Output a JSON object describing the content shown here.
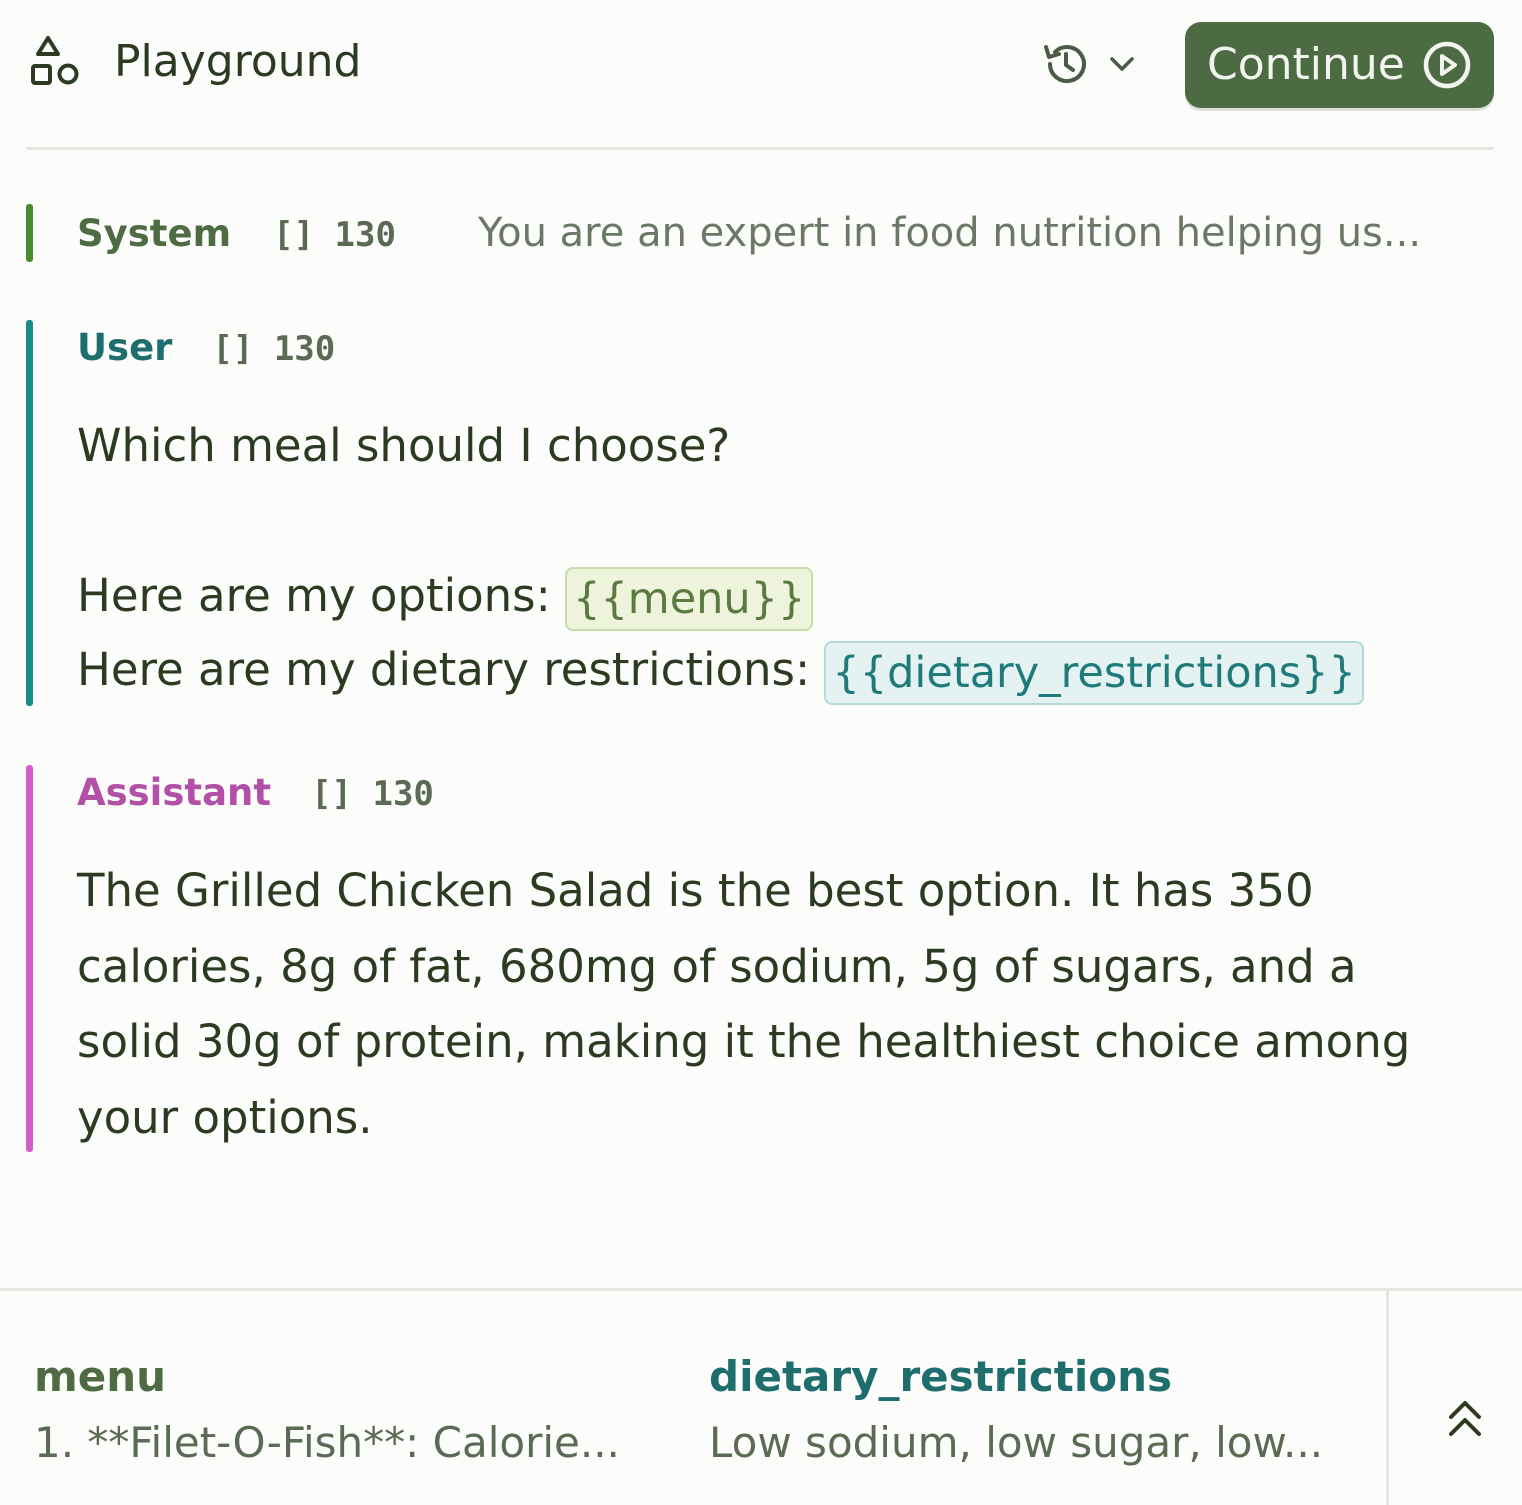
{
  "header": {
    "title": "Playground",
    "continue_label": "Continue"
  },
  "messages": {
    "system": {
      "role": "System",
      "tokens": "[] 130",
      "preview": "You are an expert in food nutrition helping us..."
    },
    "user": {
      "role": "User",
      "tokens": "[] 130",
      "line1": "Which meal should I choose?",
      "line2_prefix": "Here are my options: ",
      "line2_var": "{{menu}}",
      "line3_prefix": "Here are my dietary restrictions: ",
      "line3_var": "{{dietary_restrictions}}"
    },
    "assistant": {
      "role": "Assistant",
      "tokens": "[] 130",
      "content": "The Grilled Chicken Salad is the best option. It has 350 calories, 8g of fat, 680mg of sodium, 5g of sugars, and a solid 30g of protein, making it the healthiest choice among your options."
    }
  },
  "variables": {
    "menu": {
      "name": "menu",
      "value": "1. **Filet-O-Fish**: Calorie..."
    },
    "dietary_restrictions": {
      "name": "dietary_restrictions",
      "value": "Low sodium, low sugar, low..."
    }
  },
  "colors": {
    "system": "#4a8a2f",
    "user": "#1a8a8a",
    "assistant": "#d45ec9",
    "primary": "#4d6b43"
  },
  "icons": {
    "logo": "shapes-icon",
    "history": "history-icon",
    "dropdown": "chevron-down-icon",
    "continue": "play-circle-icon",
    "collapse": "chevrons-up-icon"
  }
}
